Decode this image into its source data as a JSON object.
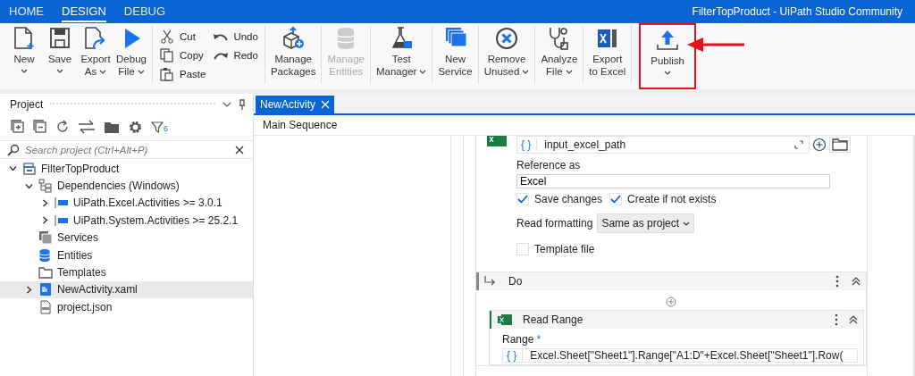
{
  "window": {
    "title": "FilterTopProduct - UiPath Studio Community"
  },
  "menu_tabs": [
    {
      "label": "HOME",
      "selected": false
    },
    {
      "label": "DESIGN",
      "selected": true
    },
    {
      "label": "DEBUG",
      "selected": false
    }
  ],
  "ribbon": {
    "groups": [
      [
        {
          "kind": "large",
          "lines": [
            "New"
          ],
          "dropdown": true,
          "disabled": false,
          "highlighted": false
        },
        {
          "kind": "large",
          "lines": [
            "Save"
          ],
          "dropdown": true,
          "disabled": false,
          "highlighted": false
        },
        {
          "kind": "large",
          "lines": [
            "Export",
            "As"
          ],
          "dropdown": true,
          "disabled": false,
          "highlighted": false
        },
        {
          "kind": "large",
          "lines": [
            "Debug",
            "File"
          ],
          "dropdown": true,
          "disabled": false,
          "highlighted": false
        }
      ],
      [
        {
          "kind": "small",
          "items": [
            {
              "label": "Cut"
            },
            {
              "label": "Copy"
            },
            {
              "label": "Paste"
            }
          ]
        },
        {
          "kind": "small",
          "items": [
            {
              "label": "Undo"
            },
            {
              "label": "Redo"
            }
          ]
        }
      ],
      [
        {
          "kind": "large",
          "lines": [
            "Manage",
            "Packages"
          ],
          "dropdown": false,
          "disabled": false,
          "highlighted": false
        }
      ],
      [
        {
          "kind": "large",
          "lines": [
            "Manage",
            "Entities"
          ],
          "dropdown": false,
          "disabled": true,
          "highlighted": false
        }
      ],
      [
        {
          "kind": "large",
          "lines": [
            "Test",
            "Manager"
          ],
          "dropdown": true,
          "disabled": false,
          "highlighted": false
        }
      ],
      [
        {
          "kind": "large",
          "lines": [
            "New",
            "Service"
          ],
          "dropdown": false,
          "disabled": false,
          "highlighted": false
        }
      ],
      [
        {
          "kind": "large",
          "lines": [
            "Remove",
            "Unused"
          ],
          "dropdown": true,
          "disabled": false,
          "highlighted": false
        }
      ],
      [
        {
          "kind": "large",
          "lines": [
            "Analyze",
            "File"
          ],
          "dropdown": true,
          "disabled": false,
          "highlighted": false
        }
      ],
      [
        {
          "kind": "large",
          "lines": [
            "Export",
            "to Excel"
          ],
          "dropdown": false,
          "disabled": false,
          "highlighted": false
        }
      ],
      [
        {
          "kind": "large",
          "lines": [
            "Publish"
          ],
          "dropdown": true,
          "disabled": false,
          "highlighted": true
        }
      ]
    ]
  },
  "project_panel": {
    "title": "Project",
    "filter_count": "6",
    "search": {
      "placeholder": "Search project (Ctrl+Alt+P)"
    },
    "tree": [
      {
        "label": "FilterTopProduct",
        "kind": "project",
        "expanded": true,
        "selected": false,
        "children": [
          {
            "label": "Dependencies (Windows)",
            "kind": "dependencies",
            "expanded": true,
            "selected": false,
            "children": [
              {
                "label": "UiPath.Excel.Activities >= 3.0.1",
                "kind": "package",
                "expanded": false,
                "selected": false
              },
              {
                "label": "UiPath.System.Activities >= 25.2.1",
                "kind": "package",
                "expanded": false,
                "selected": false
              }
            ]
          },
          {
            "label": "Services",
            "kind": "services",
            "selected": false
          },
          {
            "label": "Entities",
            "kind": "entities",
            "selected": false
          },
          {
            "label": "Templates",
            "kind": "folder",
            "selected": false
          },
          {
            "label": "NewActivity.xaml",
            "kind": "workflow",
            "expanded": false,
            "selected": true
          },
          {
            "label": "project.json",
            "kind": "json",
            "selected": false
          }
        ]
      }
    ]
  },
  "designer": {
    "tabs": [
      {
        "label": "NewActivity",
        "selected": true
      }
    ],
    "breadcrumb": "Main Sequence",
    "excel_scope": {
      "path_prefix": "{ }",
      "path": "input_excel_path",
      "reference_label": "Reference as",
      "reference_value": "Excel",
      "checkboxes": [
        {
          "label": "Save changes",
          "checked": true
        },
        {
          "label": "Create if not exists",
          "checked": true
        }
      ],
      "read_formatting_label": "Read formatting",
      "read_formatting_value": "Same as project",
      "template_file": {
        "label": "Template file",
        "checked": false
      }
    },
    "do_block": {
      "title": "Do",
      "activity": {
        "title": "Read Range",
        "field_label": "Range",
        "required_mark": "*",
        "field_prefix": "{ }",
        "field_value": "Excel.Sheet[\"Sheet1\"].Range[\"A1:D\"+Excel.Sheet[\"Sheet1\"].Row("
      }
    }
  }
}
